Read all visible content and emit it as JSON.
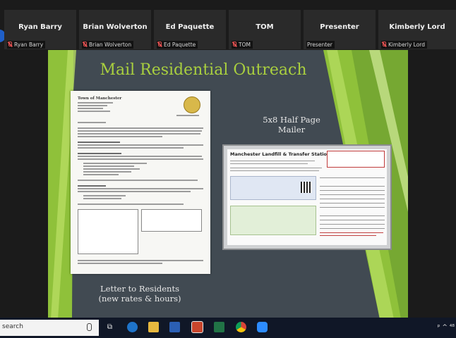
{
  "participants": [
    {
      "name": "Ryan Barry",
      "label": "Ryan Barry"
    },
    {
      "name": "Brian Wolverton",
      "label": "Brian Wolverton"
    },
    {
      "name": "Ed Paquette",
      "label": "Ed Paquette"
    },
    {
      "name": "TOM",
      "label": "TOM"
    },
    {
      "name": "Presenter",
      "label": "Presenter"
    },
    {
      "name": "Kimberly Lord",
      "label": "Kimberly Lord"
    }
  ],
  "slide": {
    "title": "Mail Residential Outreach",
    "mailer_caption_line1": "5x8 Half Page",
    "mailer_caption_line2": "Mailer",
    "letter_caption_line1": "Letter to Residents",
    "letter_caption_line2": "(new rates & hours)",
    "letter_heading": "Town of Manchester",
    "mailer_title": "Manchester Landfill & Transfer Station"
  },
  "taskbar": {
    "search_placeholder": "search",
    "tray_text": "ᵖ ^ ⁴⁸"
  },
  "colors": {
    "slide_bg": "#414a52",
    "slide_green": "#8fc13a",
    "title_green": "#a9cf3f",
    "taskbar_bg": "#101727"
  }
}
